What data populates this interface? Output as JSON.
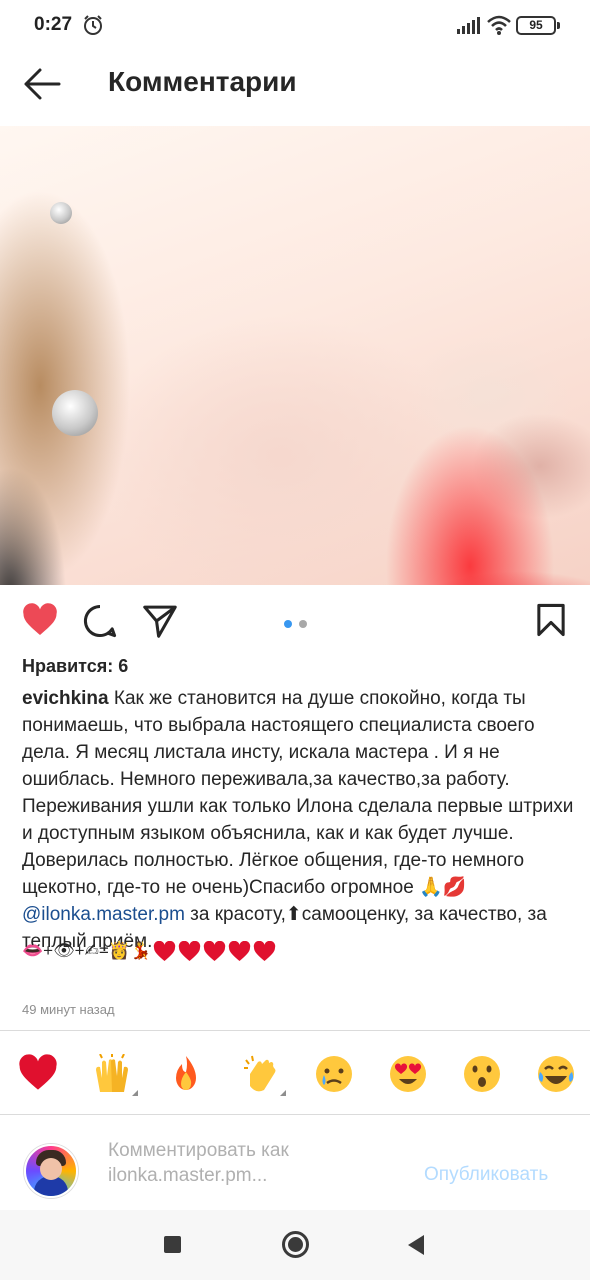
{
  "status_bar": {
    "time": "0:27",
    "battery": "95",
    "icons": [
      "alarm-icon",
      "signal-icon",
      "wifi-icon",
      "battery-icon"
    ]
  },
  "header": {
    "title": "Комментарии",
    "back_icon": "arrow-left-icon"
  },
  "post": {
    "slides_total": 2,
    "slide_active": 1,
    "liked": true,
    "action_icons": [
      "heart-icon",
      "comment-icon",
      "share-icon",
      "bookmark-icon"
    ],
    "likes_text": "Нравится: 6",
    "username": "evichkina",
    "caption_text_before_mention": "Как же становится на душе спокойно, когда ты понимаешь, что выбрала настоящего специалиста своего дела. Я месяц листала инсту, искала мастера . И я не ошиблась. Немного переживала,за качество,за работу. Переживания ушли как только Илона сделала первые штрихи и доступным языком объяснила, как и как будет лучше. Доверилась полностью. Лёгкое общения, где-то немного щекотно, где-то не очень)Спасибо огромное 🙏💋",
    "mention": "@ilonka.master.pm",
    "caption_text_after_mention": " за красоту,⬆самооценку, за качество, за теплый приём.",
    "emoji_line": "👄+👁+✍=👸💃",
    "trailing_hearts": 5,
    "time_ago": "49 минут назад"
  },
  "reactions": [
    "❤️",
    "🙌",
    "🔥",
    "👏",
    "😢",
    "😍",
    "😮",
    "😂"
  ],
  "comment_bar": {
    "placeholder": "Комментировать как ilonka.master.pm...",
    "publish_label": "Опубликовать",
    "avatar": "avatar"
  },
  "nav_bar": {
    "icons": [
      "recents-square-icon",
      "home-circle-icon",
      "back-triangle-icon"
    ]
  },
  "colors": {
    "like_red": "#ed4956",
    "link_blue": "#1b4e8f",
    "publish_disabled": "#b3dbff",
    "dot_active": "#3897f0",
    "dot_inactive": "#a8a8a8"
  }
}
